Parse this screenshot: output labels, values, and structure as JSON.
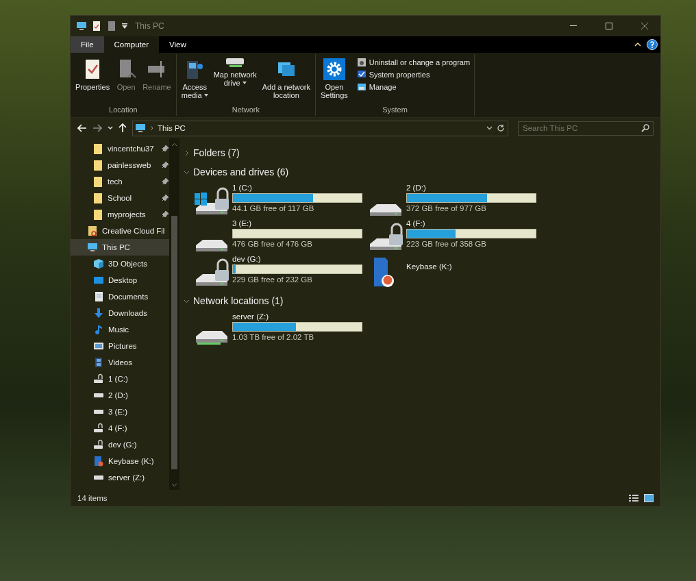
{
  "window": {
    "title": "This PC"
  },
  "tabs": [
    {
      "label": "File",
      "selected": false,
      "kind": "file"
    },
    {
      "label": "Computer",
      "selected": true,
      "kind": "tab"
    },
    {
      "label": "View",
      "selected": false,
      "kind": "tab"
    }
  ],
  "ribbon": {
    "groups": [
      {
        "label": "Location",
        "buttons": [
          {
            "kind": "properties",
            "lines": [
              "Properties"
            ],
            "disabled": false,
            "dropdown": false
          },
          {
            "kind": "open",
            "lines": [
              "Open"
            ],
            "disabled": true,
            "dropdown": false
          },
          {
            "kind": "rename",
            "lines": [
              "Rename"
            ],
            "disabled": true,
            "dropdown": false
          }
        ]
      },
      {
        "label": "Network",
        "buttons": [
          {
            "kind": "media",
            "lines": [
              "Access",
              "media"
            ],
            "disabled": false,
            "dropdown": true
          },
          {
            "kind": "mapdrive",
            "lines": [
              "Map network",
              "drive"
            ],
            "disabled": false,
            "dropdown": true
          },
          {
            "kind": "addlocation",
            "lines": [
              "Add a network",
              "location"
            ],
            "disabled": false,
            "dropdown": false
          }
        ]
      },
      {
        "label": "System",
        "buttons": [
          {
            "kind": "settings",
            "lines": [
              "Open",
              "Settings"
            ],
            "disabled": false,
            "dropdown": false
          }
        ],
        "items": [
          {
            "kind": "uninstall",
            "label": "Uninstall or change a program"
          },
          {
            "kind": "sysprops",
            "label": "System properties"
          },
          {
            "kind": "manage",
            "label": "Manage"
          }
        ]
      }
    ]
  },
  "address": {
    "path": "This PC"
  },
  "search": {
    "placeholder": "Search This PC"
  },
  "nav": [
    {
      "kind": "pinned",
      "label": "vincentchu37",
      "selected": false
    },
    {
      "kind": "pinned",
      "label": "painlessweb",
      "selected": false
    },
    {
      "kind": "pinned",
      "label": "tech",
      "selected": false
    },
    {
      "kind": "pinned",
      "label": "School",
      "selected": false
    },
    {
      "kind": "pinned",
      "label": "myprojects",
      "selected": false
    },
    {
      "kind": "cloud",
      "label": "Creative Cloud Fil",
      "selected": false
    },
    {
      "kind": "pc",
      "label": "This PC",
      "selected": true,
      "children": [
        {
          "kind": "objects3d",
          "label": "3D Objects",
          "selected": false
        },
        {
          "kind": "desktop",
          "label": "Desktop",
          "selected": false
        },
        {
          "kind": "documents",
          "label": "Documents",
          "selected": false
        },
        {
          "kind": "downloads",
          "label": "Downloads",
          "selected": false
        },
        {
          "kind": "music",
          "label": "Music",
          "selected": false
        },
        {
          "kind": "pictures",
          "label": "Pictures",
          "selected": false
        },
        {
          "kind": "videos",
          "label": "Videos",
          "selected": false
        },
        {
          "kind": "lockdrive",
          "label": "1 (C:)",
          "selected": false
        },
        {
          "kind": "drive",
          "label": "2 (D:)",
          "selected": false
        },
        {
          "kind": "drive",
          "label": "3 (E:)",
          "selected": false
        },
        {
          "kind": "lockdrive",
          "label": "4 (F:)",
          "selected": false
        },
        {
          "kind": "lockdrive",
          "label": "dev (G:)",
          "selected": false
        },
        {
          "kind": "keybase",
          "label": "Keybase (K:)",
          "selected": false
        },
        {
          "kind": "drive",
          "label": "server (Z:)",
          "selected": false
        }
      ]
    }
  ],
  "sections": [
    {
      "title": "Folders (7)",
      "expanded": false
    },
    {
      "title": "Devices and drives (6)",
      "expanded": true,
      "drives": [
        {
          "kind": "system",
          "locked": true,
          "name": "1 (C:)",
          "level": 0.62,
          "free": "44.1 GB free of 117 GB"
        },
        {
          "kind": "drive",
          "locked": false,
          "name": "2 (D:)",
          "level": 0.62,
          "free": "372 GB free of 977 GB"
        },
        {
          "kind": "drive",
          "locked": false,
          "name": "3 (E:)",
          "level": 0,
          "free": "476 GB free of 476 GB"
        },
        {
          "kind": "drive",
          "locked": true,
          "name": "4 (F:)",
          "level": 0.38,
          "free": "223 GB free of 358 GB"
        },
        {
          "kind": "drive",
          "locked": true,
          "name": "dev (G:)",
          "level": 0.02,
          "free": "229 GB free of 232 GB"
        },
        {
          "kind": "keybase",
          "locked": false,
          "name": "Keybase (K:)"
        }
      ]
    },
    {
      "title": "Network locations (1)",
      "expanded": true,
      "drives": [
        {
          "kind": "network",
          "locked": false,
          "name": "server (Z:)",
          "level": 0.49,
          "free": "1.03 TB free of 2.02 TB"
        }
      ]
    }
  ],
  "status_bar": {
    "count": "14 items"
  }
}
